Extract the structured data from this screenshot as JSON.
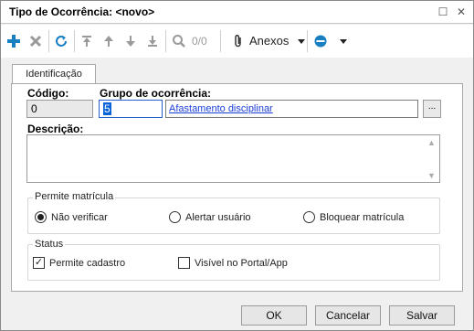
{
  "window": {
    "title": "Tipo de Ocorrência: <novo>"
  },
  "titlebar_controls": {
    "maximize": "☐",
    "close": "✕"
  },
  "toolbar": {
    "items": [
      {
        "icon": "plus-icon"
      },
      {
        "icon": "delete-icon"
      },
      {
        "icon": "refresh-icon"
      },
      {
        "icon": "first-icon"
      },
      {
        "icon": "up-icon"
      },
      {
        "icon": "down-icon"
      },
      {
        "icon": "last-icon"
      },
      {
        "icon": "search-icon"
      }
    ],
    "search_count": "0/0",
    "anexos_label": "Anexos",
    "accent": "#1a7fc1"
  },
  "tabs": [
    {
      "label": "Identificação"
    }
  ],
  "form": {
    "codigo_label": "Código:",
    "codigo_value": "0",
    "grupo_label": "Grupo de ocorrência:",
    "grupo_value": "5",
    "grupo_desc": "Afastamento disciplinar",
    "lookup_label": "...",
    "descricao_label": "Descrição:",
    "descricao_value": ""
  },
  "permite_matricula": {
    "title": "Permite matrícula",
    "options": [
      {
        "label": "Não verificar",
        "selected": true
      },
      {
        "label": "Alertar usuário",
        "selected": false
      },
      {
        "label": "Bloquear matrícula",
        "selected": false
      }
    ]
  },
  "status": {
    "title": "Status",
    "checks": [
      {
        "label": "Permite cadastro",
        "checked": true,
        "mark": "✓"
      },
      {
        "label": "Visível no Portal/App",
        "checked": false,
        "mark": ""
      }
    ]
  },
  "buttons": {
    "ok": "OK",
    "cancel": "Cancelar",
    "save": "Salvar"
  }
}
